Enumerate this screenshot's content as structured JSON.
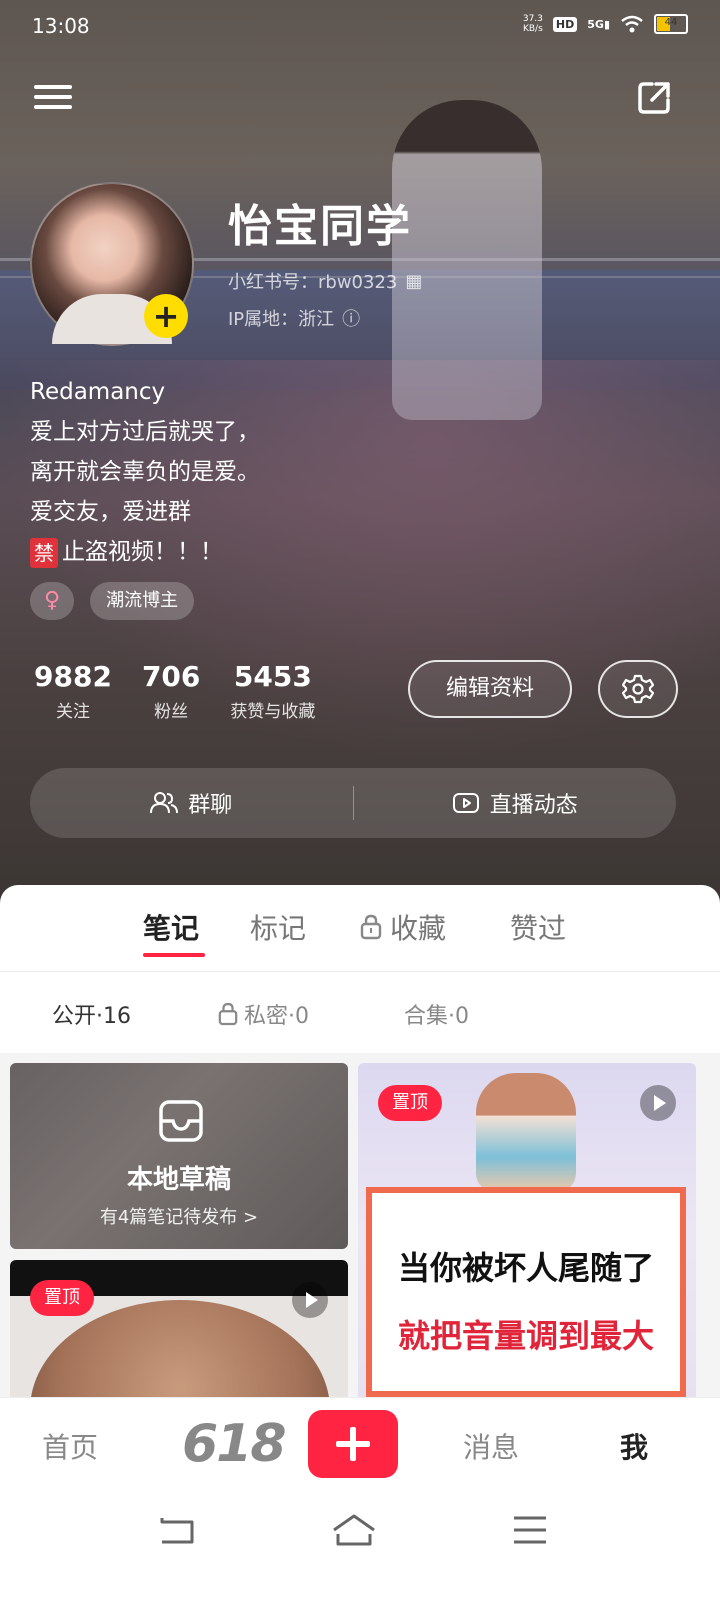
{
  "status_bar": {
    "time": "13:08",
    "net_speed_value": "37.3",
    "net_speed_unit": "KB/s",
    "hd": "HD",
    "network": "5G",
    "battery": "44"
  },
  "profile": {
    "name": "怡宝同学",
    "xhs_id": "小红书号：rbw0323",
    "ip_location": "IP属地：浙江",
    "bio_lines": [
      "Redamancy",
      "爱上对方过后就哭了，",
      "离开就会辜负的是爱。",
      "爱交友，爱进群"
    ],
    "bio_ban_icon": "禁",
    "bio_ban_text": "止盗视频！！！",
    "gender_symbol": "♀",
    "tag": "潮流博主"
  },
  "stats": [
    {
      "value": "9882",
      "label": "关注"
    },
    {
      "value": "706",
      "label": "粉丝"
    },
    {
      "value": "5453",
      "label": "获赞与收藏"
    }
  ],
  "buttons": {
    "edit_profile": "编辑资料",
    "group_chat": "群聊",
    "live": "直播动态"
  },
  "tabs": [
    "笔记",
    "标记",
    "收藏",
    "赞过"
  ],
  "subtabs": [
    "公开·16",
    "私密·0",
    "合集·0"
  ],
  "draft": {
    "title": "本地草稿",
    "subtitle": "有4篇笔记待发布 >"
  },
  "cards": {
    "pin_label": "置顶",
    "card3_line1": "当你被坏人尾随了",
    "card3_line2": "就把音量调到最大"
  },
  "bottom_nav": {
    "home": "首页",
    "promo": "618",
    "messages": "消息",
    "me": "我"
  },
  "colors": {
    "accent": "#ff2442",
    "avatar_plus": "#ffdd00"
  }
}
